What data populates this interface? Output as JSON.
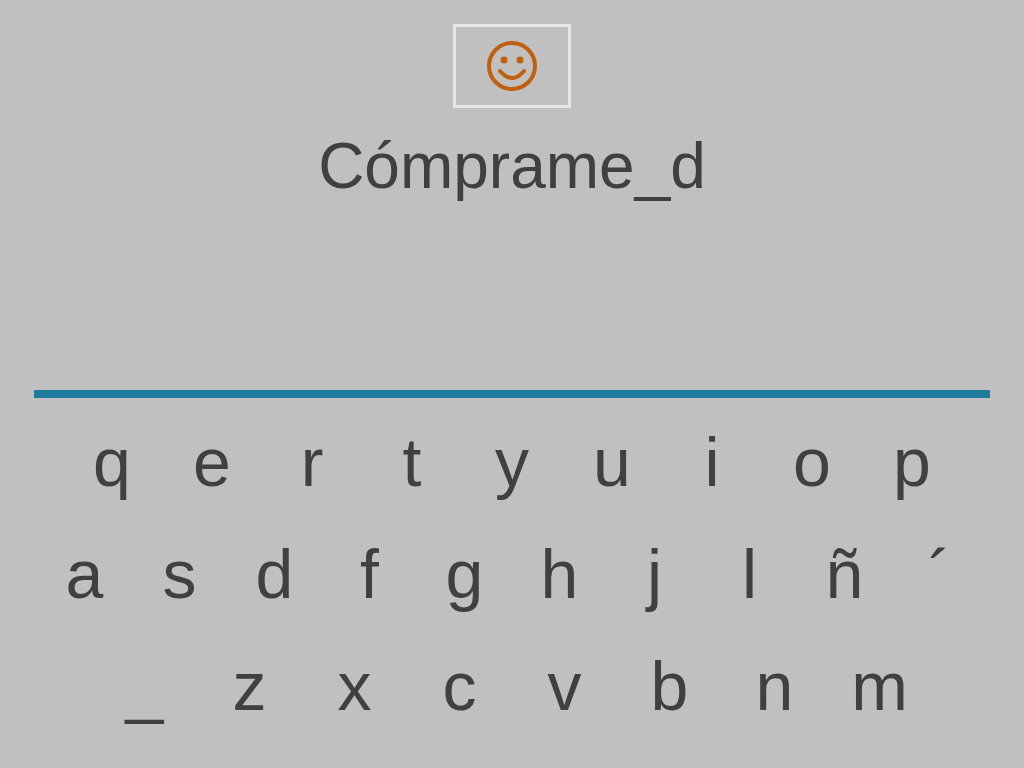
{
  "word": "Cómprame_d",
  "keyboard": [
    [
      "q",
      "e",
      "r",
      "t",
      "y",
      "u",
      "i",
      "o",
      "p"
    ],
    [
      "a",
      "s",
      "d",
      "f",
      "g",
      "h",
      "j",
      "l",
      "ñ",
      "´"
    ],
    [
      "_",
      "z",
      "x",
      "c",
      "v",
      "b",
      "n",
      "m"
    ]
  ]
}
